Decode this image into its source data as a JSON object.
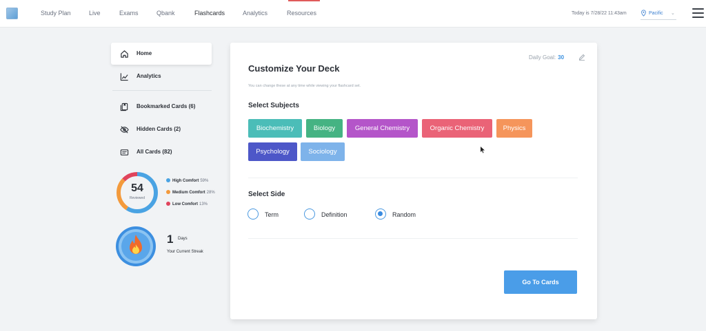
{
  "nav": {
    "items": [
      {
        "label": "Study Plan"
      },
      {
        "label": "Live"
      },
      {
        "label": "Exams"
      },
      {
        "label": "Qbank"
      },
      {
        "label": "Flashcards"
      },
      {
        "label": "Analytics"
      },
      {
        "label": "Resources"
      }
    ],
    "active": "Flashcards",
    "today": "Today is 7/28/22 11:43am",
    "timezone": "Pacific",
    "accent_color": "#e05a5a"
  },
  "sidebar": {
    "items": [
      {
        "label": "Home",
        "icon": "home-icon"
      },
      {
        "label": "Analytics",
        "icon": "chart-icon"
      },
      {
        "label": "Bookmarked Cards (6)",
        "icon": "bookmark-icon"
      },
      {
        "label": "Hidden Cards (2)",
        "icon": "eye-slash-icon"
      },
      {
        "label": "All Cards (82)",
        "icon": "cards-icon"
      }
    ],
    "reviewed": {
      "count": "54",
      "label": "Reviewed",
      "segments": [
        {
          "name": "High Comfort",
          "pct": "59%",
          "value": 59,
          "color": "#4aa3e3"
        },
        {
          "name": "Medium Comfort",
          "pct": "28%",
          "value": 28,
          "color": "#f39a3c"
        },
        {
          "name": "Low Comfort",
          "pct": "13%",
          "value": 13,
          "color": "#e0445c"
        }
      ]
    },
    "streak": {
      "count": "1",
      "unit": "Days",
      "label": "Your Current Streak",
      "icon": "flame-icon"
    }
  },
  "deck": {
    "daily_goal_label": "Daily Goal:",
    "daily_goal_value": "30",
    "title": "Customize Your Deck",
    "subtitle": "You can change these at any time while viewing your flashcard set.",
    "subjects_label": "Select Subjects",
    "subjects": [
      {
        "label": "Biochemistry",
        "color": "#4bbdb8"
      },
      {
        "label": "Biology",
        "color": "#45b383"
      },
      {
        "label": "General Chemistry",
        "color": "#b455c9"
      },
      {
        "label": "Organic Chemistry",
        "color": "#ea6377"
      },
      {
        "label": "Physics",
        "color": "#f5955b"
      },
      {
        "label": "Psychology",
        "color": "#4d57c8"
      },
      {
        "label": "Sociology",
        "color": "#7eb3ea"
      }
    ],
    "side_label": "Select Side",
    "sides": [
      {
        "label": "Term",
        "selected": false
      },
      {
        "label": "Definition",
        "selected": false
      },
      {
        "label": "Random",
        "selected": true
      }
    ],
    "button_label": "Go To Cards"
  }
}
